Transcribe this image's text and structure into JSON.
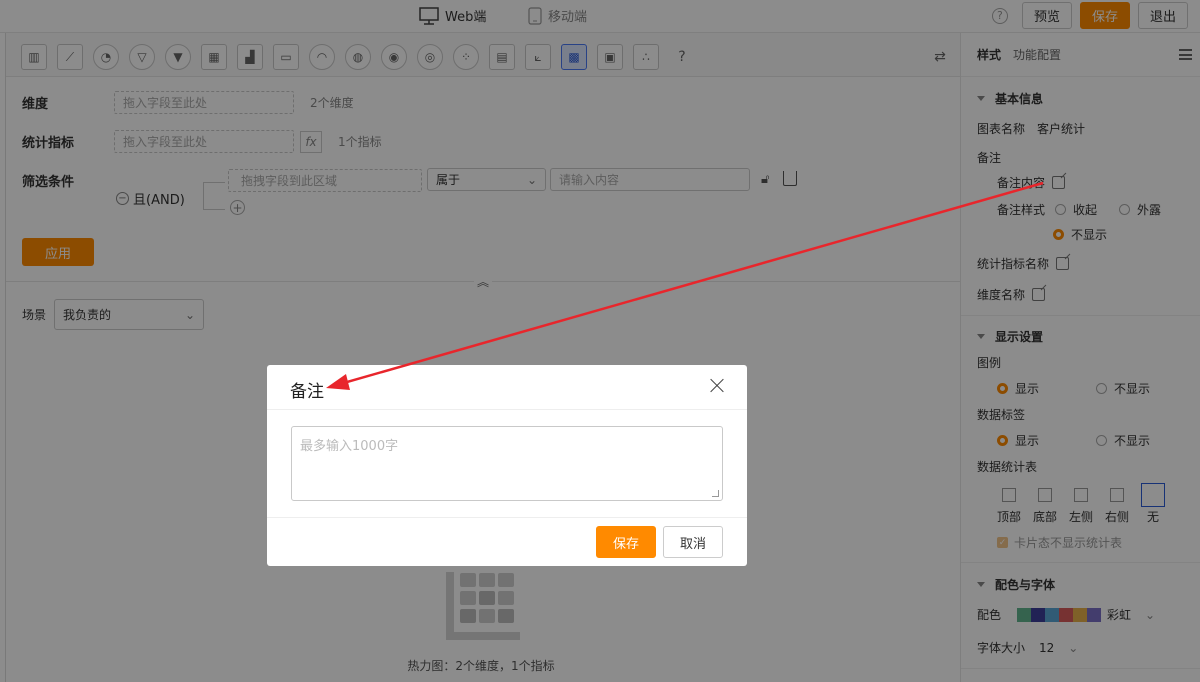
{
  "topbar": {
    "web_tab": "Web端",
    "mobile_tab": "移动端",
    "help_icon": "question-circle-icon",
    "preview": "预览",
    "save": "保存",
    "exit": "退出"
  },
  "chart_toolbar": {
    "icons": [
      "bar-chart-icon",
      "line-chart-icon",
      "pie-chart-icon",
      "funnel-icon",
      "funnel-alt-icon",
      "table-icon",
      "bar-line-icon",
      "card-icon",
      "gauge-icon",
      "map-icon",
      "map-alt-icon",
      "globe-icon",
      "scatter-icon",
      "stacked-bar-icon",
      "area-line-icon",
      "heatmap-icon",
      "pivot-table-icon",
      "bubble-icon",
      "help-icon"
    ],
    "active_index": 15,
    "swap_icon": "swap-icon"
  },
  "config": {
    "dimension_label": "维度",
    "dimension_placeholder": "拖入字段至此处",
    "dimension_hint": "2个维度",
    "metric_label": "统计指标",
    "metric_placeholder": "拖入字段至此处",
    "fx": "fx",
    "metric_hint": "1个指标",
    "filter_label": "筛选条件",
    "filter_logic": "且(AND)",
    "filter_field_placeholder": "拖拽字段到此区域",
    "filter_operator": "属于",
    "filter_value_placeholder": "请输入内容",
    "apply": "应用"
  },
  "scene": {
    "label": "场景",
    "value": "我负责的"
  },
  "preview_caption": "热力图：2个维度，1个指标",
  "side": {
    "tabs": [
      "样式",
      "功能配置"
    ],
    "basic_info": {
      "title": "基本信息",
      "chart_name_label": "图表名称",
      "chart_name_value": "客户统计",
      "remark_label": "备注",
      "remark_content_label": "备注内容",
      "remark_style_label": "备注样式",
      "remark_style_options": [
        "收起",
        "外露",
        "不显示"
      ],
      "remark_style_selected": "不显示",
      "metric_name_label": "统计指标名称",
      "dimension_name_label": "维度名称"
    },
    "display": {
      "title": "显示设置",
      "legend_label": "图例",
      "legend_options": [
        "显示",
        "不显示"
      ],
      "legend_selected": "显示",
      "data_label_label": "数据标签",
      "data_label_options": [
        "显示",
        "不显示"
      ],
      "data_label_selected": "显示",
      "stats_table_label": "数据统计表",
      "stats_positions": [
        "顶部",
        "底部",
        "左侧",
        "右侧",
        "无"
      ],
      "stats_selected": "无",
      "card_hide_label": "卡片态不显示统计表"
    },
    "colors": {
      "title": "配色与字体",
      "palette_label": "配色",
      "palette_name": "彩虹",
      "palette_colors": [
        "#62b58f",
        "#3d3f9b",
        "#5aa6d6",
        "#d95c5c",
        "#e8b14b",
        "#7b6fc7"
      ],
      "font_size_label": "字体大小",
      "font_size_value": "12"
    }
  },
  "modal": {
    "title": "备注",
    "textarea_placeholder": "最多输入1000字",
    "save": "保存",
    "cancel": "取消"
  },
  "annotation_color": "#e8262c"
}
